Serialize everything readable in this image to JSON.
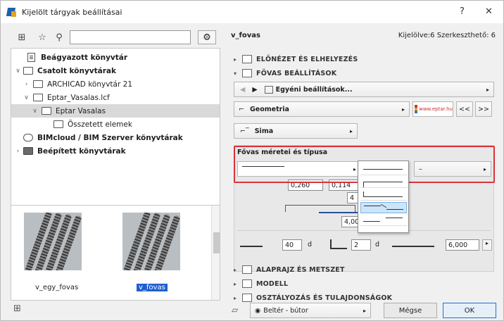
{
  "window": {
    "title": "Kijelölt tárgyak beállításai",
    "help": "?",
    "close": "✕"
  },
  "left": {
    "tree": [
      {
        "label": "Beágyazott könyvtár",
        "bold": true
      },
      {
        "label": "Csatolt könyvtárak",
        "bold": true
      },
      {
        "label": "ARCHICAD könyvtár 21",
        "bold": false
      },
      {
        "label": "Eptar_Vasalas.lcf",
        "bold": false
      },
      {
        "label": "Eptar Vasalas",
        "bold": false
      },
      {
        "label": "Összetett elemek",
        "bold": false
      },
      {
        "label": "BIMcloud / BIM Szerver könyvtárak",
        "bold": true
      },
      {
        "label": "Beépített könyvtárak",
        "bold": true
      }
    ],
    "thumbs": [
      {
        "caption": "v_egy_fovas"
      },
      {
        "caption": "v_fovas"
      }
    ]
  },
  "right": {
    "object_name": "v_fovas",
    "selection_info": "Kijelölve:6 Szerkeszthető: 6",
    "sections": {
      "preview": "ELŐNÉZET ÉS ELHELYEZÉS",
      "fovas": "FŐVAS BEÁLLÍTÁSOK",
      "floorplan": "ALAPRAJZ ÉS METSZET",
      "model": "MODELL",
      "classification": "OSZTÁLYOZÁS ÉS TULAJDONSÁGOK"
    },
    "custom_settings": "Egyéni beállítások...",
    "geometry_label": "Geometria",
    "logo_text": "www.eptar.hu",
    "prev": "<<",
    "next": ">>",
    "sima_label": "Sima",
    "fovas_size_label": "Fővas méretei és típusa",
    "dims": {
      "a": "0,260",
      "b": "0,114",
      "c": "4",
      "d": "4,00"
    },
    "bottom": {
      "len1": "40",
      "unit1": "d",
      "len2": "2",
      "unit2": "d",
      "len3": "6,000"
    },
    "layer": "Beltér - bútor",
    "cancel": "Mégse",
    "ok": "OK"
  }
}
